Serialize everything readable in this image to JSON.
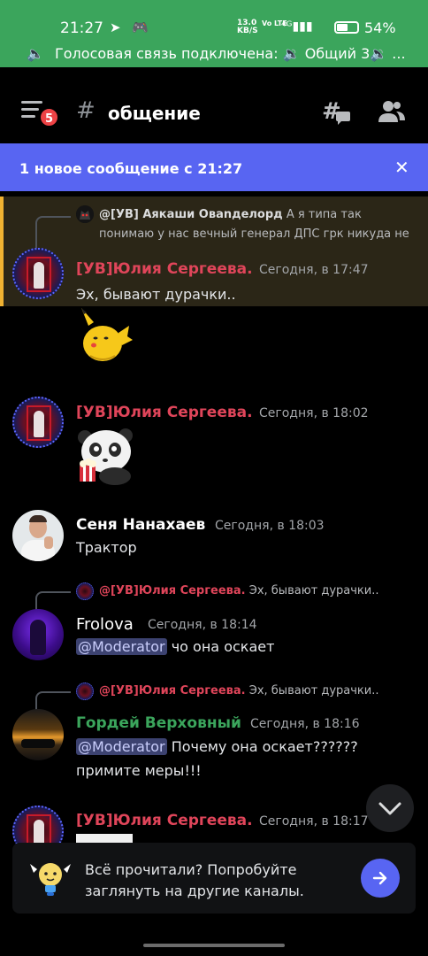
{
  "status_bar": {
    "time": "21:27",
    "app_icons": "➤ 🎮",
    "net_speed_value": "13.0",
    "net_speed_unit": "KB/S",
    "volte": "Vo LTE",
    "signal": "⁴ᴳ▮▮▮",
    "battery_percent": "54%",
    "battery_level": 0.54
  },
  "voice_bar": {
    "text": "Голосовая связь подключена: 🔉 Общий 3🔉 ..."
  },
  "header": {
    "unread_badge": "5",
    "hash": "#",
    "channel_name": "общение"
  },
  "new_messages_banner": {
    "text": "1 новое сообщение с 21:27",
    "close": "✕"
  },
  "messages": [
    {
      "reply_author": "@[УВ] Аякаши Овanделорд",
      "reply_line1": "А я типа так",
      "reply_line2": "понимаю у нас вечный генерал ДПС грк никуда не",
      "author": "[УВ]Юлия Сергеева.",
      "timestamp": "Сегодня, в 17:47",
      "text": "Эх, бывают дурачки.."
    },
    {
      "author": "[УВ]Юлия Сергеева.",
      "timestamp": "Сегодня, в 18:02"
    },
    {
      "author": "Сеня Нанахаев",
      "timestamp": "Сегодня, в 18:03",
      "text": "Трактор"
    },
    {
      "reply_author": "@[УВ]Юлия Сергеева.",
      "reply_text": "Эх, бывают дурачки..",
      "author": "Frolova",
      "timestamp": "Сегодня, в 18:14",
      "mention": "@Moderator",
      "text": "чо она оскает"
    },
    {
      "reply_author": "@[УВ]Юлия Сергеева.",
      "reply_text": "Эх, бывают дурачки..",
      "author": "Гордей Верховный",
      "timestamp": "Сегодня, в 18:16",
      "mention": "@Moderator",
      "text": "Почему она оскает??????",
      "text_line2": "примите меры!!!"
    },
    {
      "author": "[УВ]Юлия Сергеева.",
      "timestamp": "Сегодня, в 18:17"
    }
  ],
  "caught_up": {
    "line1": "Всё прочитали? Попробуйте",
    "line2": "заглянуть на другие каналы."
  },
  "colors": {
    "status_green": "#3ba55c",
    "blurple": "#5865f2",
    "name_red": "#e0455a",
    "name_green": "#3ba55c",
    "highlight_bar": "#f0b232"
  },
  "icons": [
    "menu-icon",
    "hash-icon",
    "threads-icon",
    "members-icon",
    "close-icon",
    "chevron-down-icon",
    "arrow-right-icon",
    "lightbulb-icon",
    "speaker-icon"
  ]
}
